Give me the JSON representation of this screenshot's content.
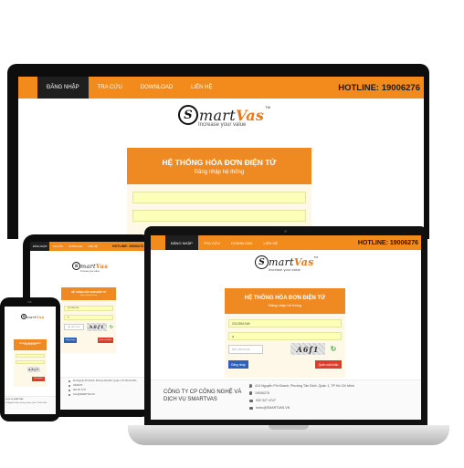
{
  "nav": {
    "items": [
      "ĐĂNG NHẬP",
      "TRA CỨU",
      "DOWNLOAD",
      "LIÊN HỆ"
    ],
    "hotline": "HOTLINE: 19006276"
  },
  "brand": {
    "name_prefix": "S",
    "name_main": "mart",
    "name_accent": "Vas",
    "trademark": "TM",
    "tagline": "Increase your value"
  },
  "login": {
    "title": "HỆ THỐNG HÓA ĐƠN ĐIỆN TỬ",
    "subtitle": "Đăng nhập hệ thống",
    "username_value": "0312861948",
    "password_value": "●",
    "captcha_placeholder": "MÃ CAPTCHA",
    "captcha_text": "A6f1",
    "login_button": "Đăng nhập",
    "forgot_button": "Quên mật khẩu"
  },
  "footer": {
    "company_line1": "CÔNG TY CP CÔNG NGHỆ VÀ",
    "company_line2": "DỊCH VỤ SMARTVAS",
    "address": "414 Nguyễn Phi Khanh, Phường Tân Định, Quận 1, TP Hồ Chí Minh",
    "hotline": "19006276",
    "phone": "092 327 4747",
    "email": "hotro@SMARTVAS.VN"
  },
  "colors": {
    "brand_orange": "#f28a1c",
    "login_blue": "#2e62b8",
    "forgot_red": "#e03a2a",
    "field_yellow": "#fbffb8"
  }
}
